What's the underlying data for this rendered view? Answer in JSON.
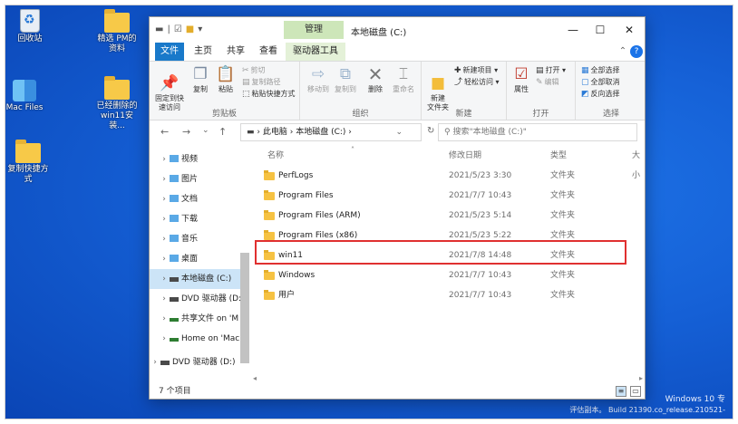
{
  "desktop": {
    "icons": [
      {
        "label": "回收站"
      },
      {
        "label": "Mac Files"
      },
      {
        "label": "复制快捷方式"
      },
      {
        "label": "精选 PM的\n资料"
      },
      {
        "label": "已经删除的\nwin11安装..."
      }
    ],
    "watermark": {
      "line1": "Windows 10 专",
      "line2": "评估副本。 Build 21390.co_release.210521-"
    }
  },
  "window": {
    "title": "本地磁盘 (C:)",
    "context_tab": "管理",
    "controls": {
      "minimize": "—",
      "maximize": "☐",
      "close": "✕"
    }
  },
  "tabs": [
    "文件",
    "主页",
    "共享",
    "查看",
    "驱动器工具"
  ],
  "ribbon": {
    "clipboard": {
      "name": "剪贴板",
      "pin": "固定到快\n速访问",
      "copy": "复制",
      "paste": "粘贴",
      "cut": "剪切",
      "copy_path": "复制路径",
      "paste_shortcut": "粘贴快捷方式"
    },
    "organize": {
      "name": "组织",
      "move_to": "移动到",
      "copy_to": "复制到",
      "delete": "删除",
      "rename": "重命名"
    },
    "new": {
      "name": "新建",
      "new_folder": "新建\n文件夹",
      "new_item": "新建项目",
      "easy_access": "轻松访问"
    },
    "open": {
      "name": "打开",
      "properties": "属性",
      "open": "打开",
      "edit": "编辑"
    },
    "select": {
      "name": "选择",
      "select_all": "全部选择",
      "select_none": "全部取消",
      "invert": "反向选择"
    }
  },
  "address": {
    "nav": {
      "back": "←",
      "forward": "→",
      "recent": "⌄",
      "up": "↑",
      "refresh": "↻"
    },
    "path": [
      "此电脑",
      "本地磁盘 (C:)"
    ],
    "search_placeholder": "搜索\"本地磁盘 (C:)\""
  },
  "navpane": {
    "items": [
      {
        "label": "视频",
        "kind": "folder"
      },
      {
        "label": "图片",
        "kind": "folder"
      },
      {
        "label": "文档",
        "kind": "folder"
      },
      {
        "label": "下载",
        "kind": "folder"
      },
      {
        "label": "音乐",
        "kind": "folder"
      },
      {
        "label": "桌面",
        "kind": "folder"
      },
      {
        "label": "本地磁盘 (C:)",
        "kind": "drive",
        "selected": true
      },
      {
        "label": "DVD 驱动器 (D:",
        "kind": "drive"
      },
      {
        "label": "共享文件 on 'M",
        "kind": "net"
      },
      {
        "label": "Home on 'Mac",
        "kind": "net"
      },
      {
        "label": "DVD 驱动器 (D:)",
        "kind": "drive"
      }
    ]
  },
  "list": {
    "columns": {
      "name": "名称",
      "date": "修改日期",
      "type": "类型",
      "size": "大小"
    },
    "rows": [
      {
        "name": "PerfLogs",
        "date": "2021/5/23 3:30",
        "type": "文件夹"
      },
      {
        "name": "Program Files",
        "date": "2021/7/7 10:43",
        "type": "文件夹"
      },
      {
        "name": "Program Files (ARM)",
        "date": "2021/5/23 5:14",
        "type": "文件夹"
      },
      {
        "name": "Program Files (x86)",
        "date": "2021/5/23 5:22",
        "type": "文件夹"
      },
      {
        "name": "win11",
        "date": "2021/7/8 14:48",
        "type": "文件夹"
      },
      {
        "name": "Windows",
        "date": "2021/7/7 10:43",
        "type": "文件夹"
      },
      {
        "name": "用户",
        "date": "2021/7/7 10:43",
        "type": "文件夹"
      }
    ]
  },
  "status": {
    "count": "7 个项目"
  },
  "colors": {
    "accent": "#1979ca",
    "highlight_border": "#e03030",
    "desktop": "#1560d6"
  }
}
